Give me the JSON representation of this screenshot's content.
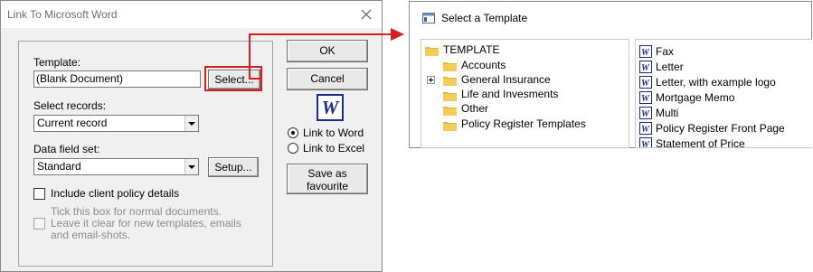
{
  "link_dialog": {
    "title": "Link To Microsoft Word",
    "template_label": "Template:",
    "template_value": "(Blank Document)",
    "select_button": "Select...",
    "select_records_label": "Select records:",
    "select_records_value": "Current record",
    "data_field_label": "Data field set:",
    "data_field_value": "Standard",
    "setup_button": "Setup...",
    "include_client_label": "Include client policy details",
    "include_client_checked": false,
    "tick_note_line1": "Tick this box for normal documents.",
    "tick_note_line2": "Leave it clear for new templates, emails",
    "tick_note_line3": "and email-shots.",
    "ok_button": "OK",
    "cancel_button": "Cancel",
    "word_logo_letter": "W",
    "radio_link_word": "Link to Word",
    "radio_link_excel": "Link to Excel",
    "radio_selected": "Link to Word",
    "save_favourite_line1": "Save as",
    "save_favourite_line2": "favourite"
  },
  "template_dialog": {
    "title": "Select a Template",
    "tree": {
      "root": "TEMPLATE",
      "children": [
        "Accounts",
        "General Insurance",
        "Life and Invesments",
        "Other",
        "Policy Register Templates"
      ]
    },
    "files": [
      "Fax",
      "Letter",
      "Letter, with example logo",
      "Mortgage Memo",
      "Multi",
      "Policy Register Front Page",
      "Statement of Price"
    ]
  },
  "colors": {
    "highlight": "#d41f1f",
    "folder": "#e8b63a",
    "word_blue": "#1a2b8c"
  }
}
